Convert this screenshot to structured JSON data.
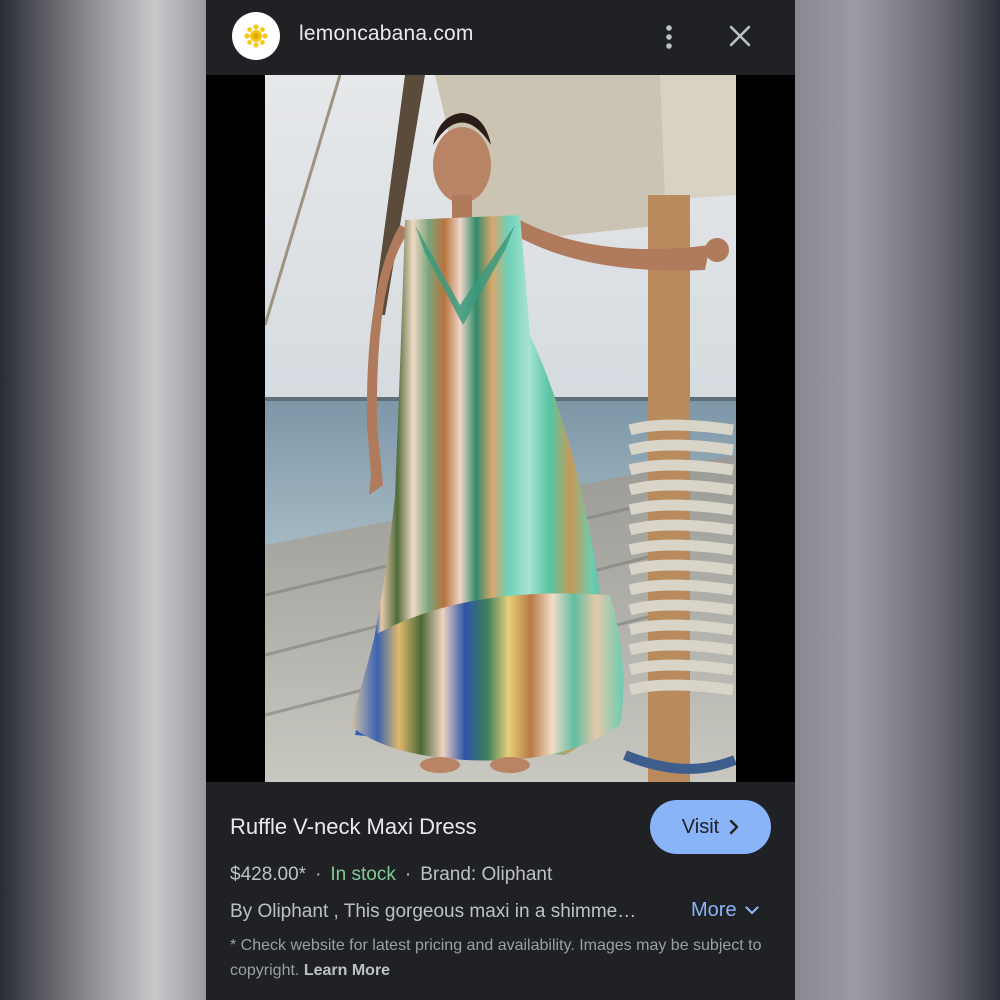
{
  "header": {
    "site_name": "lemoncabana.com",
    "favicon_icon": "lemon-flower-icon",
    "more_icon": "more-vertical-icon",
    "close_icon": "close-icon"
  },
  "image": {
    "alt": "Ruffle V-neck Maxi Dress"
  },
  "product": {
    "title": "Ruffle V-neck Maxi Dress",
    "visit_label": "Visit",
    "price": "$428.00*",
    "stock": "In stock",
    "brand": "Brand: Oliphant",
    "description": "By Oliphant , This gorgeous maxi in a shimme…",
    "more_label": "More",
    "disclaimer": "* Check website for latest pricing and availability. Images may be subject to copyright.",
    "learn_more_label": "Learn More"
  },
  "colors": {
    "panel_bg": "#202124",
    "accent": "#8ab4f8",
    "stock_green": "#81c995",
    "favicon_yellow": "#f5c518"
  }
}
